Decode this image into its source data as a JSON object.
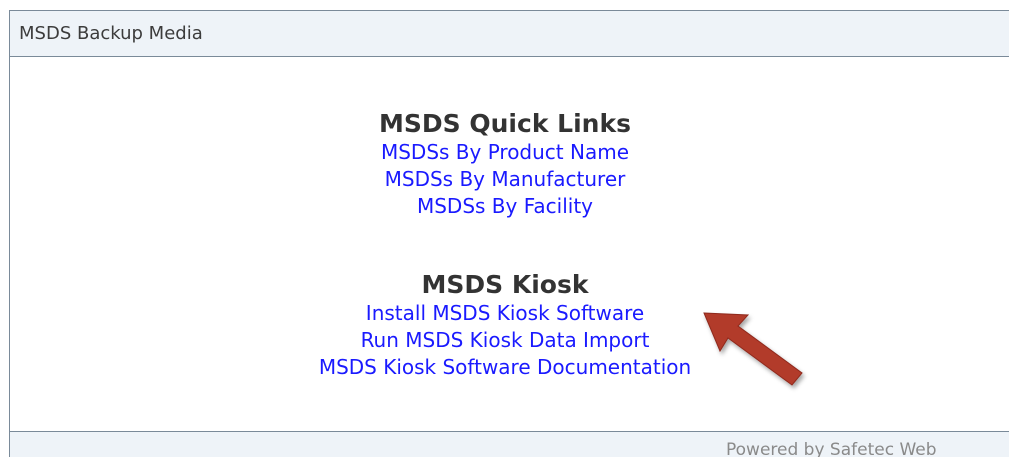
{
  "header": {
    "title": "MSDS Backup Media"
  },
  "quick_links": {
    "heading": "MSDS Quick Links",
    "links": [
      "MSDSs By Product Name",
      "MSDSs By Manufacturer",
      "MSDSs By Facility"
    ]
  },
  "kiosk": {
    "heading": "MSDS Kiosk",
    "links": [
      "Install MSDS Kiosk Software",
      "Run MSDS Kiosk Data Import",
      "MSDS Kiosk Software Documentation"
    ]
  },
  "footer": {
    "text": "Powered by Safetec Web"
  },
  "colors": {
    "link": "#1a1aff",
    "header_bg": "#eef3f8",
    "border": "#7a8a99",
    "arrow": "#b23a2a"
  },
  "annotation": {
    "icon": "red-arrow-icon"
  }
}
